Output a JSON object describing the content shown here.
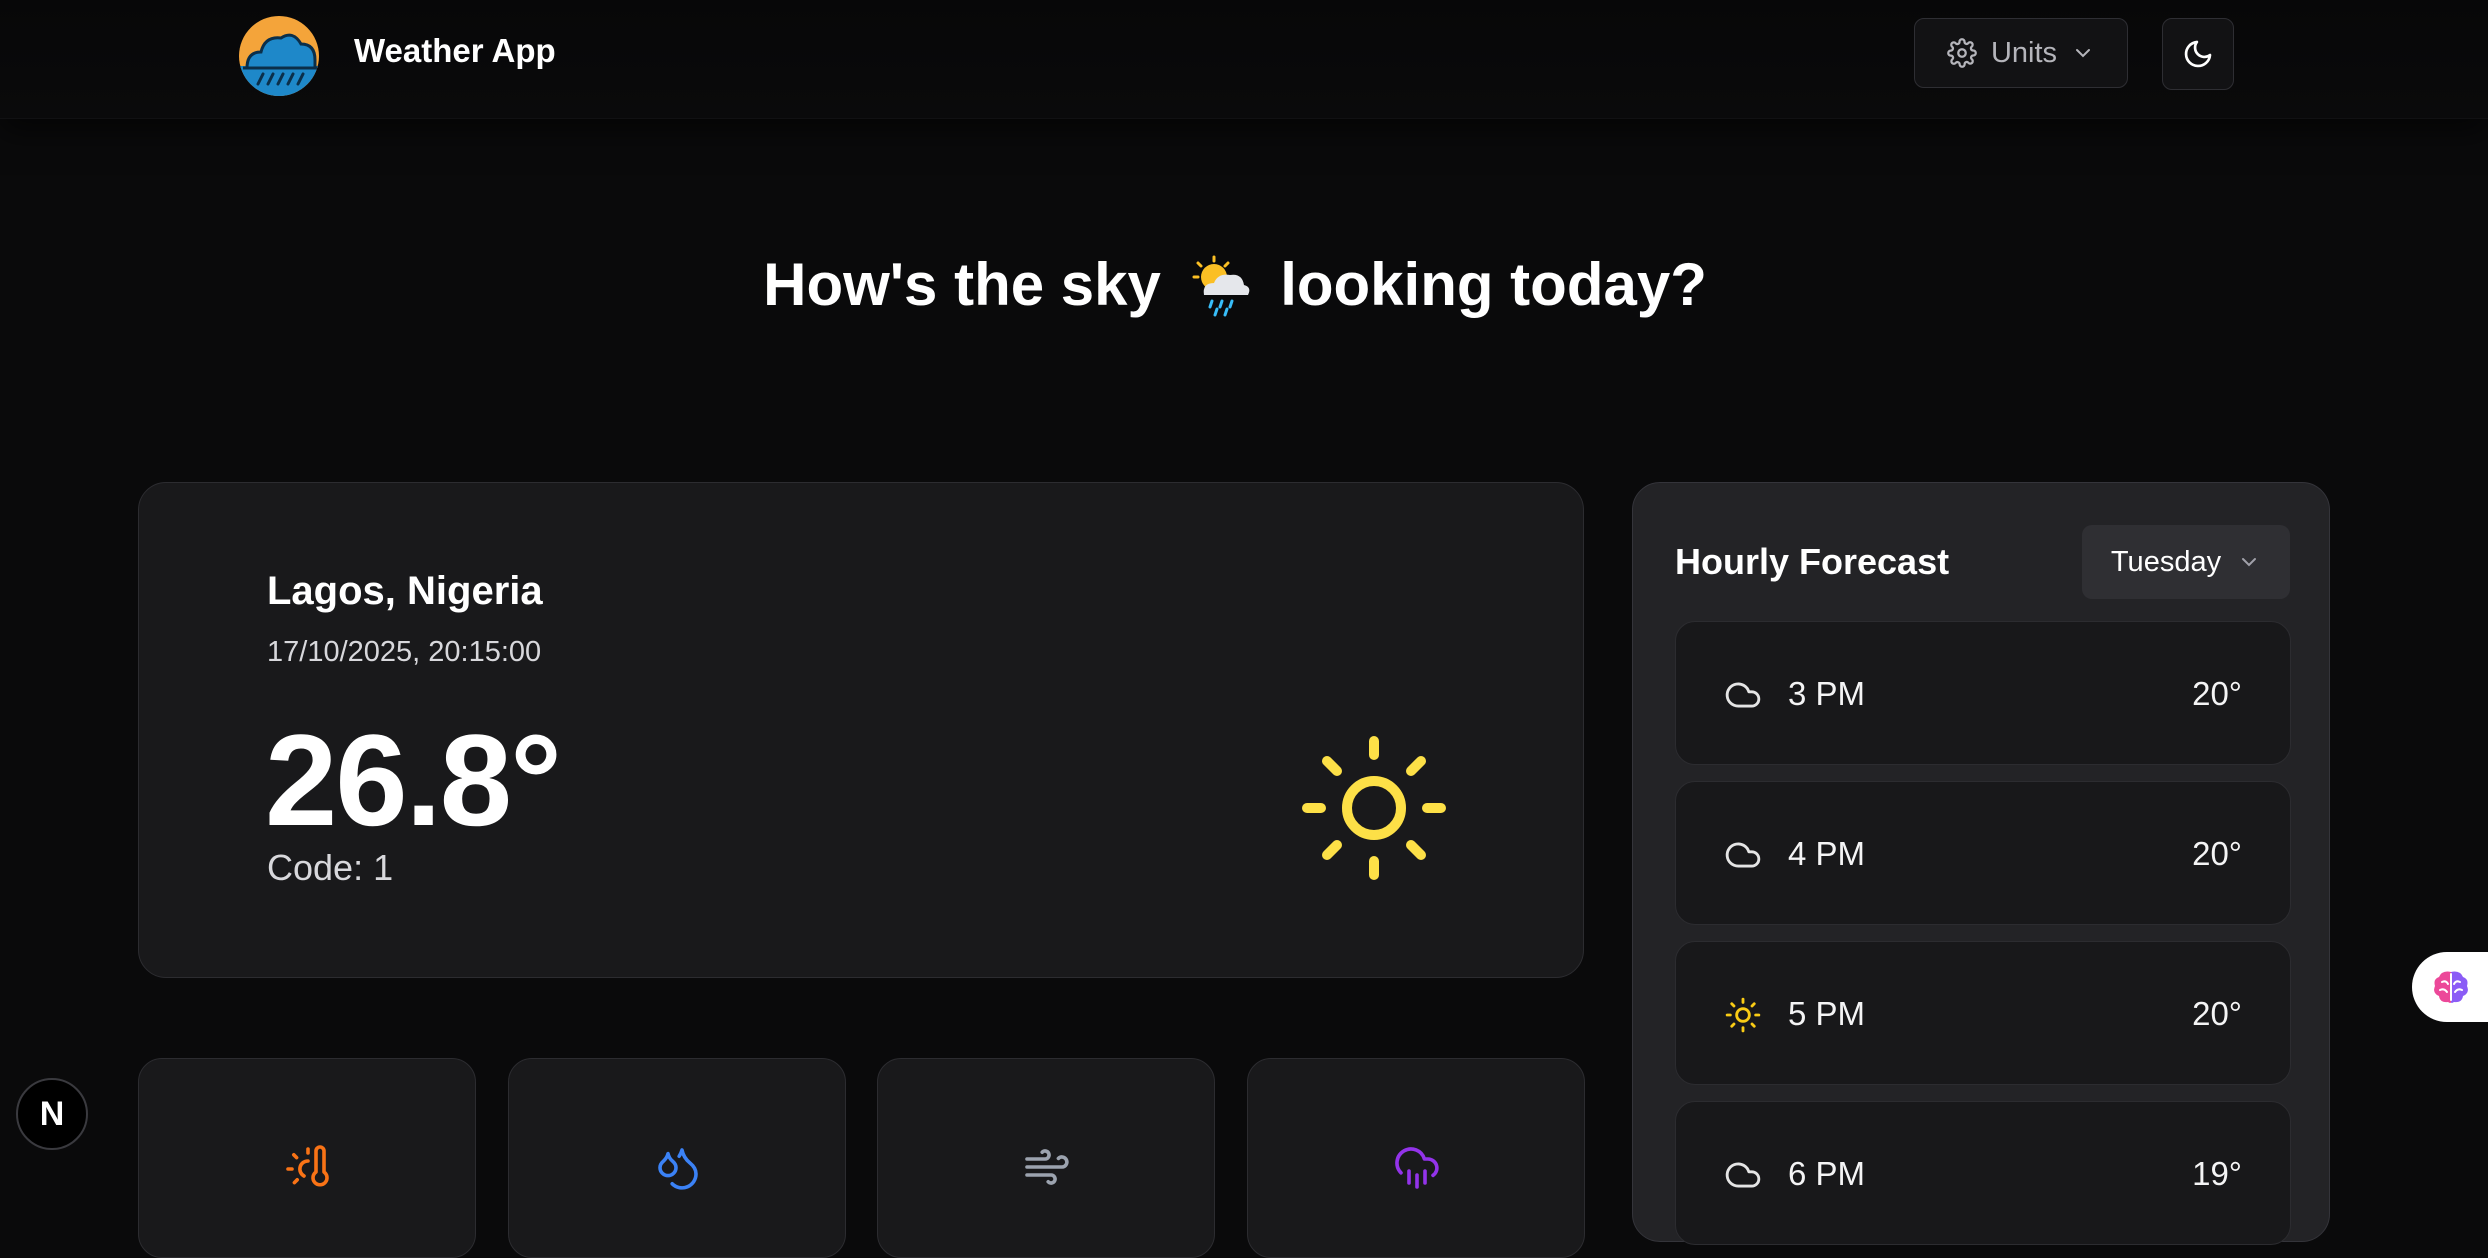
{
  "header": {
    "app_title": "Weather App",
    "logo_icon": "cloud-rain-logo-icon",
    "units_label": "Units",
    "units_icon": "gear-icon",
    "theme_icon": "moon-icon"
  },
  "hero": {
    "headline_before": "How's the sky",
    "headline_after": "looking today?",
    "emoji_icon": "sun-behind-rain-cloud-icon"
  },
  "current": {
    "location": "Lagos, Nigeria",
    "datetime": "17/10/2025, 20:15:00",
    "temperature": "26.8°",
    "code": "Code: 1",
    "condition_icon": "sun-icon"
  },
  "stats": [
    {
      "icon": "thermometer-sun-icon",
      "color": "#f97316"
    },
    {
      "icon": "droplets-icon",
      "color": "#3b82f6"
    },
    {
      "icon": "wind-icon",
      "color": "#9ca3af"
    },
    {
      "icon": "cloud-rain-icon",
      "color": "#9333ea"
    }
  ],
  "hourly": {
    "title": "Hourly Forecast",
    "selected_day": "Tuesday",
    "rows": [
      {
        "time": "3 PM",
        "temp": "20°",
        "icon": "cloud-icon"
      },
      {
        "time": "4 PM",
        "temp": "20°",
        "icon": "cloud-icon"
      },
      {
        "time": "5 PM",
        "temp": "20°",
        "icon": "sun-icon"
      },
      {
        "time": "6 PM",
        "temp": "19°",
        "icon": "cloud-icon"
      }
    ]
  },
  "overlays": {
    "next_badge_label": "N",
    "brain_icon": "brain-icon"
  },
  "colors": {
    "background": "#0a0a0b",
    "card": "#19191b",
    "sun_yellow": "#fde047",
    "logo_orange": "#f4a43a",
    "logo_blue": "#1e88c9"
  }
}
